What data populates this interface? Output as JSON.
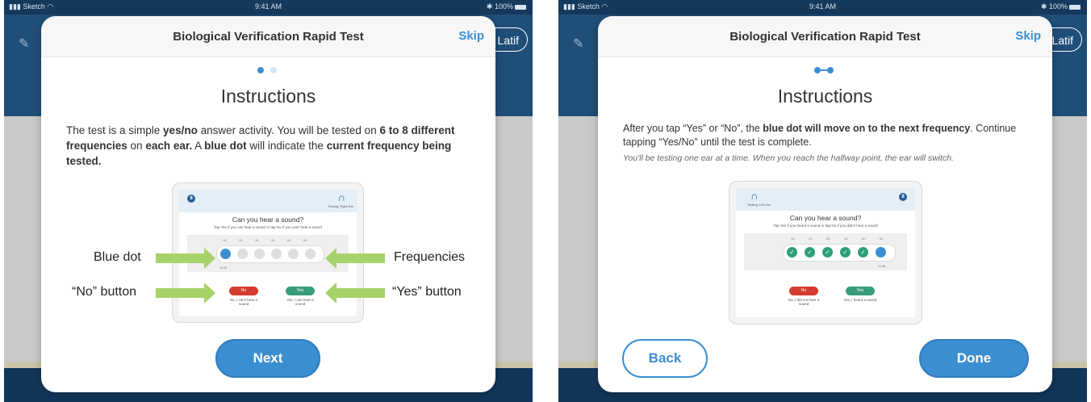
{
  "status": {
    "carrier": "Sketch",
    "time": "9:41 AM",
    "battery": "100%"
  },
  "app": {
    "user_label": "Latif"
  },
  "colors": {
    "accent": "#3b8ed0",
    "navbar": "#1f4e78",
    "no": "#d63b2f",
    "yes": "#3a9d7e",
    "arrow": "#a6d26a"
  },
  "panels": [
    {
      "title": "Biological Verification Rapid Test",
      "skip": "Skip",
      "heading": "Instructions",
      "p_a": "The test is a simple ",
      "p_b": "yes/no",
      "p_c": " answer activity. You will be tested on ",
      "p_d": "6 to 8 different frequencies",
      "p_e": " on ",
      "p_f": "each ear.",
      "p_g": " A ",
      "p_h": "blue dot",
      "p_i": " will indicate the ",
      "p_j": "current frequency being tested.",
      "mock": {
        "badge": "8",
        "ear": "Testing: Right Ear",
        "question": "Can you hear a sound?",
        "sub": "Tap Yes if you can hear a sound or tap No if you can't hear a sound",
        "freqs": [
          "1K",
          "2K",
          "3K",
          "4K",
          "6K",
          "8K"
        ],
        "db": "25dB",
        "no": "No",
        "yes": "Yes",
        "no_caption": "No, I can't hear a sound",
        "yes_caption": "Yes, I can hear a sound"
      },
      "callouts": {
        "blue_dot": "Blue dot",
        "frequencies": "Frequencies",
        "no_button": "“No” button",
        "yes_button": "“Yes” button"
      },
      "next": "Next"
    },
    {
      "title": "Biological Verification Rapid Test",
      "skip": "Skip",
      "heading": "Instructions",
      "p_a": "After you tap “Yes” or “No”, the ",
      "p_b": "blue dot will move on to the next frequency",
      "p_c": ". Continue tapping “Yes/No” until the test is complete.",
      "italic": "You'll be testing one ear at a time. When you reach the halfway point, the ear will switch.",
      "mock": {
        "badge": "8",
        "ear": "Testing: Left Ear",
        "question": "Can you hear a sound?",
        "sub": "Tap Yes if you heard a sound or tap No if you didn't hear a sound",
        "freqs": [
          "1K",
          "2K",
          "3K",
          "4K",
          "6K",
          "8K"
        ],
        "db": "25dB",
        "no": "No",
        "yes": "Yes",
        "no_caption": "No, I did not hear a sound",
        "yes_caption": "Yes, I heard a sound"
      },
      "back": "Back",
      "done": "Done"
    }
  ]
}
